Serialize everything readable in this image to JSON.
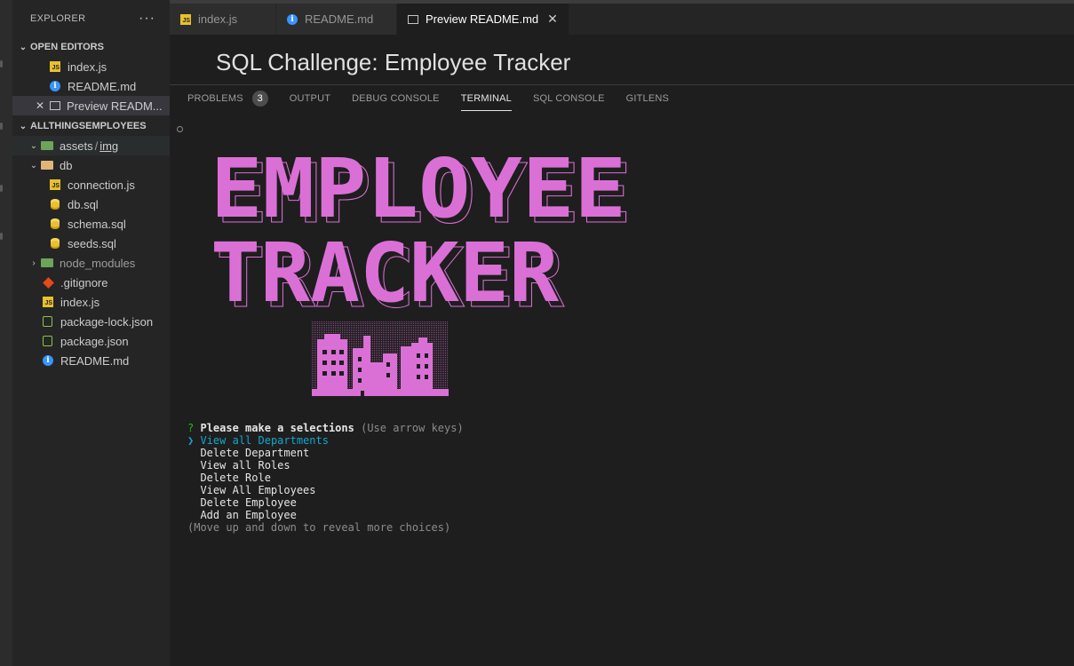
{
  "explorer": {
    "title": "EXPLORER",
    "more": "···",
    "open_editors": {
      "heading": "OPEN EDITORS",
      "items": [
        {
          "label": "index.js"
        },
        {
          "label": "README.md"
        },
        {
          "label": "Preview READM..."
        }
      ]
    },
    "project": {
      "heading": "ALLTHINGSEMPLOYEES",
      "assets_folder": "assets",
      "assets_sep": "/",
      "assets_sub": "img",
      "db_folder": "db",
      "db_files": [
        "connection.js",
        "db.sql",
        "schema.sql",
        "seeds.sql"
      ],
      "node_modules": "node_modules",
      "root_files": [
        ".gitignore",
        "index.js",
        "package-lock.json",
        "package.json",
        "README.md"
      ]
    }
  },
  "tabs": [
    {
      "label": "index.js"
    },
    {
      "label": "README.md"
    },
    {
      "label": "Preview README.md",
      "close": "✕"
    }
  ],
  "preview": {
    "title": "SQL Challenge: Employee Tracker"
  },
  "panel": {
    "tabs": [
      "PROBLEMS",
      "OUTPUT",
      "DEBUG CONSOLE",
      "TERMINAL",
      "SQL CONSOLE",
      "GITLENS"
    ],
    "problems_count": "3",
    "active_tab": "TERMINAL"
  },
  "banner": {
    "line1": "EMPLOYEE",
    "line2": "TRACKER",
    "color": "#da70d6"
  },
  "terminal": {
    "prompt_mark": "?",
    "prompt": "Please make a selections",
    "hint": "(Use arrow keys)",
    "pointer": "❯",
    "choices": [
      "View all Departments",
      "Delete Department",
      "View all Roles",
      "Delete Role",
      "View All Employees",
      "Delete Employee",
      "Add an Employee"
    ],
    "footer": "(Move up and down to reveal more choices)"
  }
}
